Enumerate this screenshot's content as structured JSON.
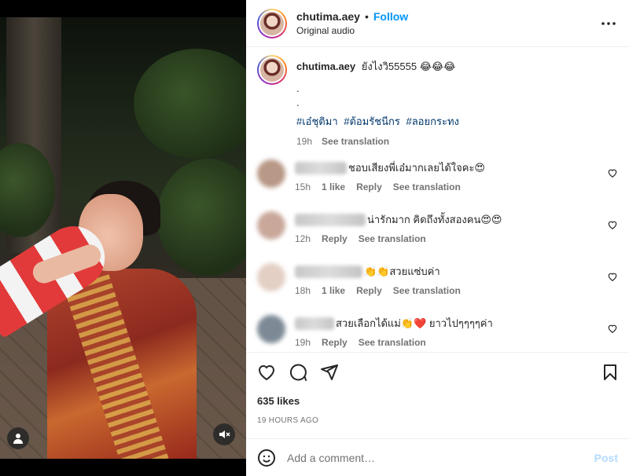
{
  "post": {
    "username": "chutima.aey",
    "dot": "•",
    "follow_label": "Follow",
    "audio": "Original audio"
  },
  "caption": {
    "username": "chutima.aey",
    "text": "ยังไงวิ55555 😂😂😂",
    "dot1": ".",
    "dot2": ".",
    "hashtags": [
      "#เอ๋ชุติมา",
      "#ต้อมรัชนีกร",
      "#ลอยกระทง"
    ],
    "time": "19h",
    "see_translation": "See translation"
  },
  "comments": [
    {
      "name_blur": true,
      "text": "ชอบเสียงพี่เอ๋มากเลยได้ใจคะ😍",
      "time": "15h",
      "likes": "1 like",
      "reply": "Reply",
      "see_translation": "See translation",
      "avatar_color": "#b89886"
    },
    {
      "name_blur": true,
      "text": "น่ารักมาก คิดถึงทั้งสองคน😍😍",
      "time": "12h",
      "likes": "",
      "reply": "Reply",
      "see_translation": "See translation",
      "avatar_color": "#c9a89a"
    },
    {
      "name_blur": true,
      "text": "👏👏สวยแซ่บค่า",
      "time": "18h",
      "likes": "1 like",
      "reply": "Reply",
      "see_translation": "See translation",
      "avatar_color": "#e3cfc4"
    },
    {
      "name_blur": true,
      "text": "สวยเลือกได้แม่👏❤️ ยาวไปๆๆๆๆค่า",
      "time": "19h",
      "likes": "",
      "reply": "Reply",
      "see_translation": "See translation",
      "avatar_color": "#7d8a96"
    }
  ],
  "actions": {
    "likes": "635 likes",
    "timestamp": "19 HOURS AGO"
  },
  "add_comment": {
    "placeholder": "Add a comment…",
    "post_label": "Post"
  },
  "icons": {
    "more": "more-horizontal-icon",
    "heart": "heart-icon",
    "comment": "comment-icon",
    "share": "share-icon",
    "bookmark": "bookmark-icon",
    "emoji": "emoji-icon",
    "user": "user-tag-icon",
    "mute": "muted-speaker-icon"
  },
  "colors": {
    "accent": "#0095f6",
    "hashtag": "#00376b",
    "muted": "#737373",
    "post_disabled": "#b3dbff"
  }
}
